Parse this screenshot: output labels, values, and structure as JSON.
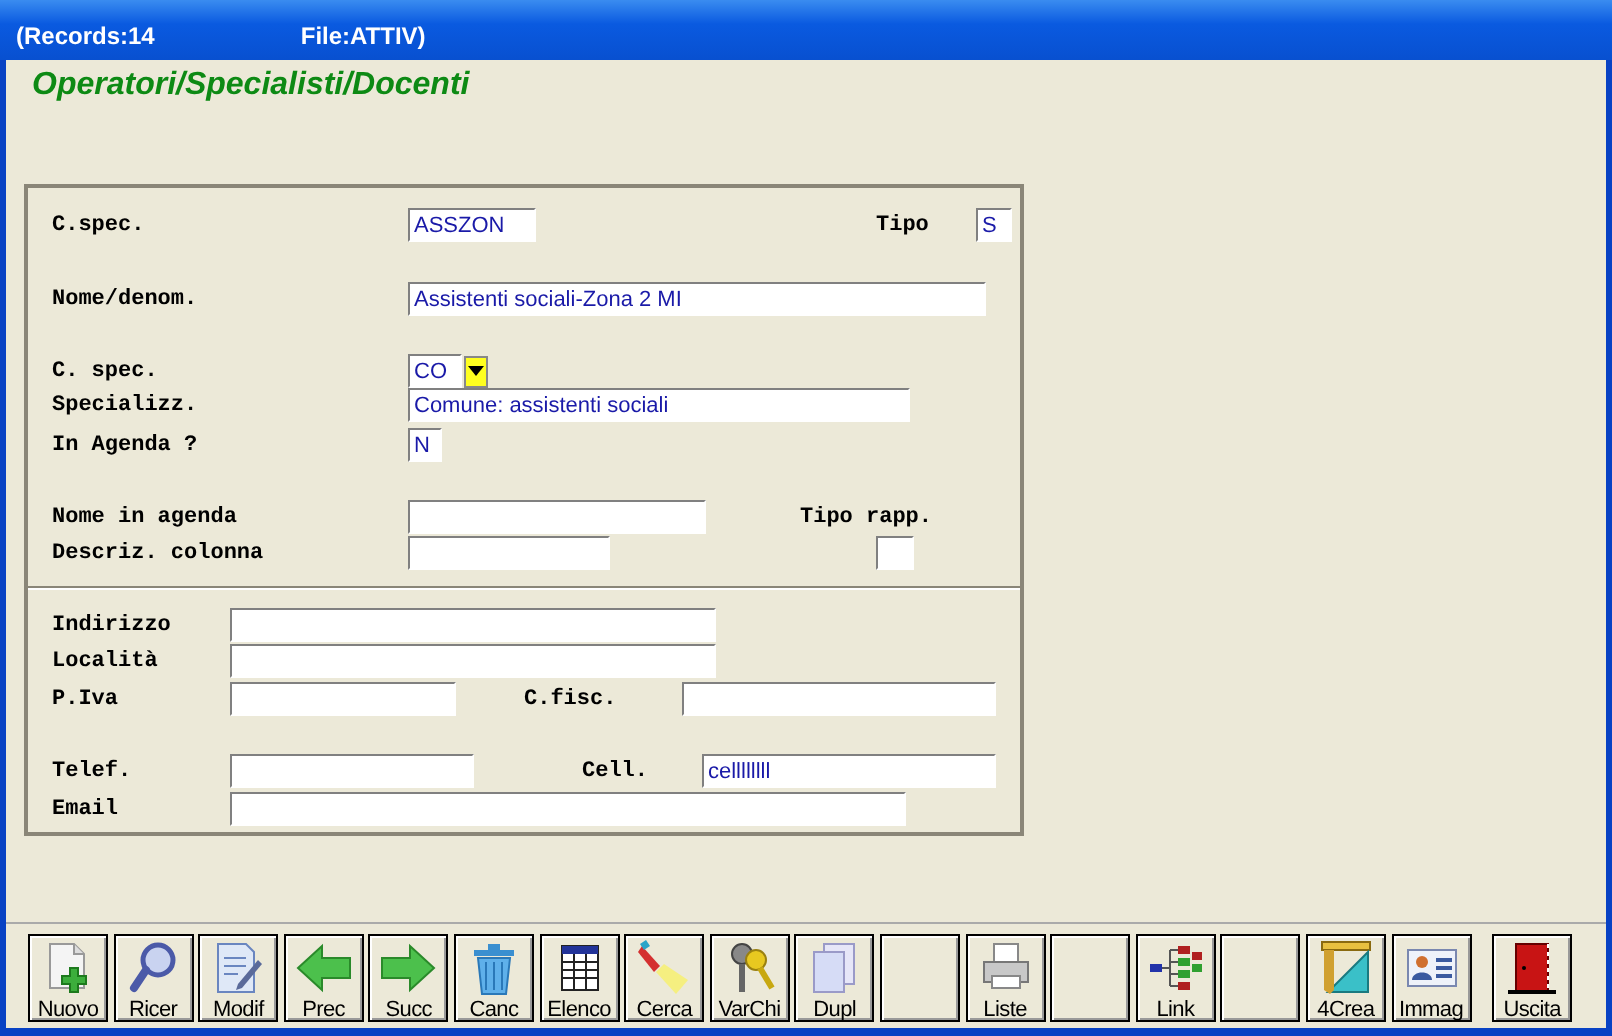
{
  "window": {
    "title_left": "(Records:14",
    "title_right": "File:ATTIV)"
  },
  "heading": "Operatori/Specialisti/Docenti",
  "form": {
    "sections": [
      {
        "rows": [
          {
            "fields": [
              {
                "kind": "text-field",
                "label": "C.spec.",
                "value": "ASSZON"
              },
              {
                "kind": "text-field",
                "label": "Tipo",
                "value": "S"
              }
            ]
          },
          {
            "fields": [
              {
                "kind": "text-field",
                "label": "Nome/denom.",
                "value": "Assistenti sociali-Zona 2 MI"
              }
            ]
          },
          {
            "fields": [
              {
                "kind": "dropdown",
                "label": "C. spec.",
                "value": "CO"
              }
            ]
          },
          {
            "fields": [
              {
                "kind": "text-field",
                "label": "Specializz.",
                "value": "Comune: assistenti sociali"
              }
            ]
          },
          {
            "fields": [
              {
                "kind": "text-field",
                "label": "In Agenda ?",
                "value": "N"
              }
            ]
          },
          {
            "fields": [
              {
                "kind": "text-field",
                "label": "Nome in agenda"
              },
              {
                "kind": "caption",
                "label": "Tipo rapp."
              }
            ]
          },
          {
            "fields": [
              {
                "kind": "text-field",
                "label": "Descriz. colonna"
              },
              {
                "kind": "text-field"
              }
            ]
          }
        ]
      },
      {
        "rows": [
          {
            "fields": [
              {
                "kind": "text-field",
                "label": "Indirizzo"
              }
            ]
          },
          {
            "fields": [
              {
                "kind": "text-field",
                "label": "Località"
              }
            ]
          },
          {
            "fields": [
              {
                "kind": "text-field",
                "label": "P.Iva"
              },
              {
                "kind": "text-field",
                "label": "C.fisc."
              }
            ]
          },
          {
            "fields": [
              {
                "kind": "text-field",
                "label": "Telef."
              },
              {
                "kind": "text-field",
                "label": "Cell.",
                "value": "cellllllll"
              }
            ]
          },
          {
            "fields": [
              {
                "kind": "text-field",
                "label": "Email"
              }
            ]
          }
        ]
      }
    ]
  },
  "toolbar": [
    {
      "kind": "button",
      "label": "Nuovo"
    },
    {
      "kind": "button",
      "label": "Ricer"
    },
    {
      "kind": "button",
      "label": "Modif"
    },
    {
      "kind": "button",
      "label": "Prec"
    },
    {
      "kind": "button",
      "label": "Succ"
    },
    {
      "kind": "button",
      "label": "Canc"
    },
    {
      "kind": "button",
      "label": "Elenco"
    },
    {
      "kind": "button",
      "label": "Cerca"
    },
    {
      "kind": "button",
      "label": "VarChi"
    },
    {
      "kind": "button",
      "label": "Dupl"
    },
    {
      "kind": "blank"
    },
    {
      "kind": "button",
      "label": "Liste"
    },
    {
      "kind": "blank"
    },
    {
      "kind": "button",
      "label": "Link"
    },
    {
      "kind": "blank"
    },
    {
      "kind": "button",
      "label": "4Crea"
    },
    {
      "kind": "button",
      "label": "Immag"
    },
    {
      "kind": "button",
      "label": "Uscita"
    }
  ]
}
